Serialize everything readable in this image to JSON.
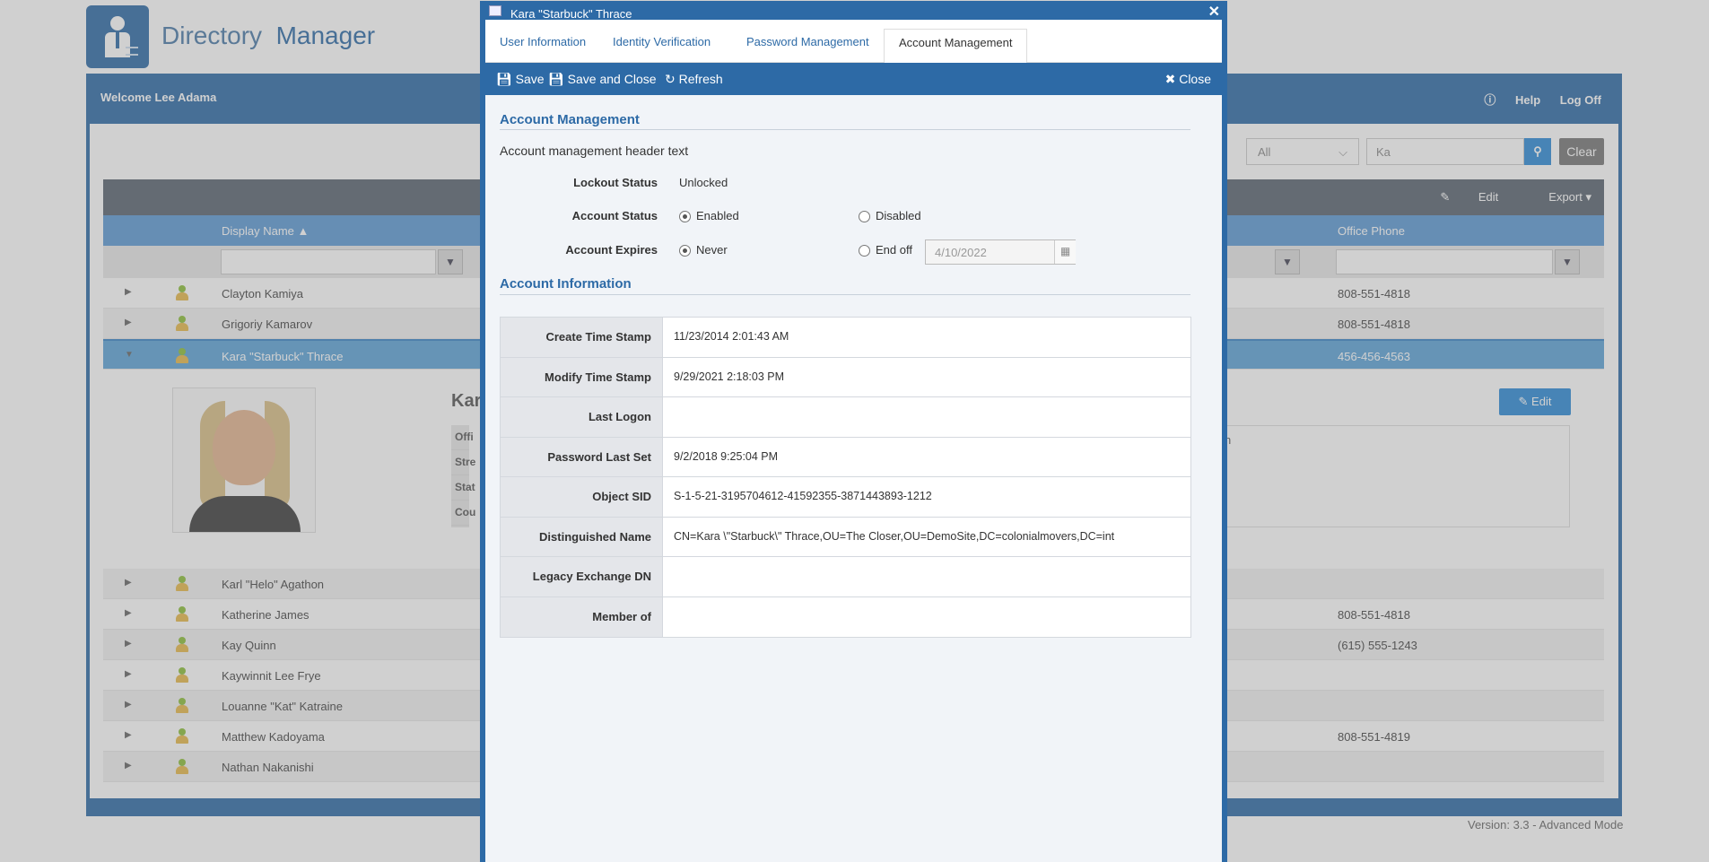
{
  "app": {
    "logo_text_1": "Directory",
    "logo_text_2": "Manager",
    "welcome": "Welcome Lee Adama",
    "help": "Help",
    "logoff": "Log Off",
    "version": "Version: 3.3 - Advanced Mode"
  },
  "search": {
    "scope": "All",
    "query": "Ka",
    "clear": "Clear"
  },
  "grid": {
    "edit": "Edit",
    "export": "Export",
    "col_display_name": "Display Name",
    "col_office_phone": "Office Phone",
    "rows": [
      {
        "name": "Clayton Kamiya",
        "phone": "808-551-4818"
      },
      {
        "name": "Grigoriy Kamarov",
        "phone": "808-551-4818"
      },
      {
        "name": "Kara \"Starbuck\" Thrace",
        "phone": "456-456-4563"
      },
      {
        "name": "Karl \"Helo\" Agathon",
        "phone": ""
      },
      {
        "name": "Katherine James",
        "phone": "808-551-4818"
      },
      {
        "name": "Kay Quinn",
        "phone": "(615) 555-1243"
      },
      {
        "name": "Kaywinnit Lee Frye",
        "phone": ""
      },
      {
        "name": "Louanne \"Kat\" Katraine",
        "phone": ""
      },
      {
        "name": "Matthew Kadoyama",
        "phone": "808-551-4819"
      },
      {
        "name": "Nathan Nakanishi",
        "phone": ""
      }
    ],
    "detail_name": "Kar",
    "detail_labels": [
      "Offi",
      "Stre",
      "Stat",
      "Cou"
    ],
    "detail_partial": "n",
    "detail_edit": "Edit"
  },
  "modal": {
    "title": "Kara \"Starbuck\" Thrace",
    "tabs": [
      "User Information",
      "Identity Verification",
      "Password Management",
      "Account Management"
    ],
    "toolbar": {
      "save": "Save",
      "save_close": "Save and Close",
      "refresh": "Refresh",
      "close": "Close"
    },
    "section1": "Account Management",
    "header_text": "Account management header text",
    "lockout_label": "Lockout Status",
    "lockout_value": "Unlocked",
    "account_status_label": "Account Status",
    "enabled": "Enabled",
    "disabled": "Disabled",
    "account_expires_label": "Account Expires",
    "never": "Never",
    "end_of": "End off",
    "end_date": "4/10/2022",
    "section2": "Account Information",
    "info": [
      {
        "k": "Create Time Stamp",
        "v": "11/23/2014 2:01:43 AM"
      },
      {
        "k": "Modify Time Stamp",
        "v": "9/29/2021 2:18:03 PM"
      },
      {
        "k": "Last Logon",
        "v": ""
      },
      {
        "k": "Password Last Set",
        "v": "9/2/2018 9:25:04 PM"
      },
      {
        "k": "Object SID",
        "v": "S-1-5-21-3195704612-41592355-3871443893-1212"
      },
      {
        "k": "Distinguished Name",
        "v": "CN=Kara \\\"Starbuck\\\" Thrace,OU=The Closer,OU=DemoSite,DC=colonialmovers,DC=int"
      },
      {
        "k": "Legacy Exchange DN",
        "v": ""
      },
      {
        "k": "Member of",
        "v": ""
      }
    ]
  }
}
